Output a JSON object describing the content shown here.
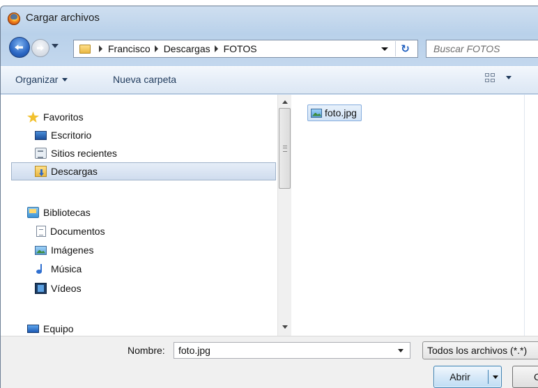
{
  "window": {
    "title": "Cargar archivos"
  },
  "address": {
    "crumbs": [
      "Francisco",
      "Descargas",
      "FOTOS"
    ]
  },
  "search": {
    "placeholder": "Buscar FOTOS"
  },
  "toolbar": {
    "organize_label": "Organizar",
    "new_folder_label": "Nueva carpeta"
  },
  "sidebar": {
    "items": [
      {
        "label": "Favoritos",
        "icon": "star-icon"
      },
      {
        "label": "Escritorio",
        "icon": "desktop-icon"
      },
      {
        "label": "Sitios recientes",
        "icon": "recent-places-icon"
      },
      {
        "label": "Descargas",
        "icon": "downloads-folder-icon",
        "selected": true
      },
      {
        "label": "Bibliotecas",
        "icon": "libraries-icon"
      },
      {
        "label": "Documentos",
        "icon": "documents-icon"
      },
      {
        "label": "Imágenes",
        "icon": "images-icon"
      },
      {
        "label": "Música",
        "icon": "music-icon"
      },
      {
        "label": "Vídeos",
        "icon": "videos-icon"
      },
      {
        "label": "Equipo",
        "icon": "computer-icon"
      }
    ]
  },
  "files": [
    {
      "name": "foto.jpg",
      "icon": "image-file-icon",
      "selected": true
    }
  ],
  "footer": {
    "name_label": "Nombre:",
    "name_value": "foto.jpg",
    "filetype_value": "Todos los archivos (*.*)",
    "open_label": "Abrir",
    "cancel_label": "Cancelar"
  },
  "colors": {
    "accent": "#3c7fb1",
    "selection": "#cfdcee",
    "window_frame": "#b9d1ea"
  }
}
